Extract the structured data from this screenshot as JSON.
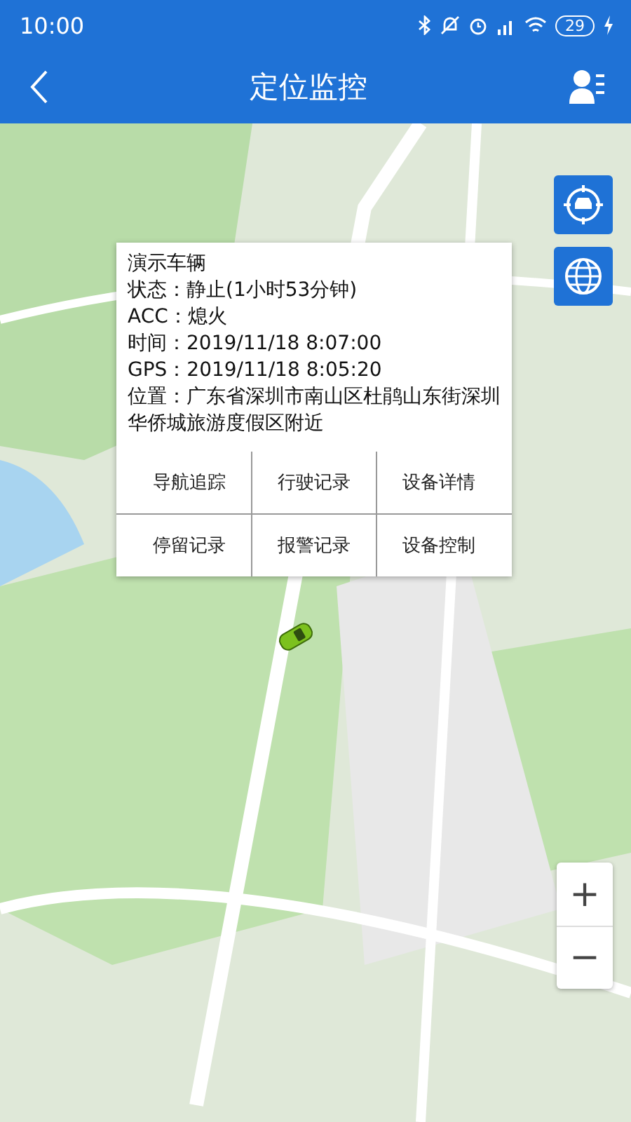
{
  "status_bar": {
    "time": "10:00",
    "battery": "29"
  },
  "app_bar": {
    "title": "定位监控"
  },
  "popup": {
    "title": "演示车辆",
    "lines": [
      "状态：静止(1小时53分钟)",
      "ACC：熄火",
      "时间：2019/11/18 8:07:00",
      "GPS：2019/11/18 8:05:20",
      "位置：广东省深圳市南山区杜鹃山东街深圳华侨城旅游度假区附近"
    ],
    "actions": [
      [
        "导航追踪",
        "行驶记录",
        "设备详情"
      ],
      [
        "停留记录",
        "报警记录",
        "设备控制"
      ]
    ]
  },
  "zoom": {
    "in": "+",
    "out": "−"
  }
}
